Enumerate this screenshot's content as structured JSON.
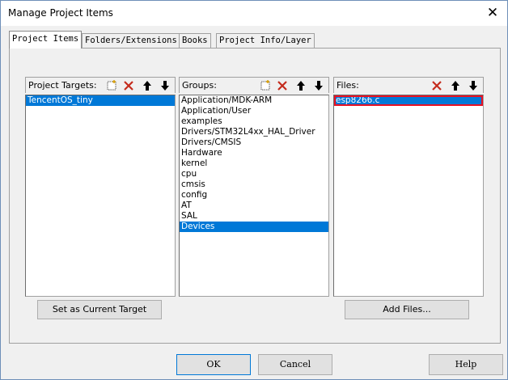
{
  "window": {
    "title": "Manage Project Items",
    "close_glyph": "✕"
  },
  "tabs": [
    {
      "label": "Project Items",
      "active": true
    },
    {
      "label": "Folders/Extensions",
      "active": false
    },
    {
      "label": "Books",
      "active": false
    },
    {
      "label": "Project Info/Layer",
      "active": false
    }
  ],
  "targets": {
    "header": "Project Targets:",
    "items": [
      "TencentOS_tiny"
    ],
    "selected_index": 0,
    "toolbar_icons": [
      "new-icon",
      "delete-icon",
      "move-up-icon",
      "move-down-icon"
    ],
    "button_label": "Set as Current Target"
  },
  "groups": {
    "header": "Groups:",
    "items": [
      "Application/MDK-ARM",
      "Application/User",
      "examples",
      "Drivers/STM32L4xx_HAL_Driver",
      "Drivers/CMSIS",
      "Hardware",
      "kernel",
      "cpu",
      "cmsis",
      "config",
      "AT",
      "SAL",
      "Devices"
    ],
    "selected_index": 12,
    "toolbar_icons": [
      "new-icon",
      "delete-icon",
      "move-up-icon",
      "move-down-icon"
    ]
  },
  "files": {
    "header": "Files:",
    "items": [
      "esp8266.c"
    ],
    "selected_index": 0,
    "toolbar_icons": [
      "delete-icon",
      "move-up-icon",
      "move-down-icon"
    ],
    "button_label": "Add Files..."
  },
  "footer": {
    "ok_label": "OK",
    "cancel_label": "Cancel",
    "help_label": "Help"
  },
  "colors": {
    "selection": "#0078d7",
    "focus_outline": "#e81123",
    "delete_red": "#c42b1c"
  }
}
